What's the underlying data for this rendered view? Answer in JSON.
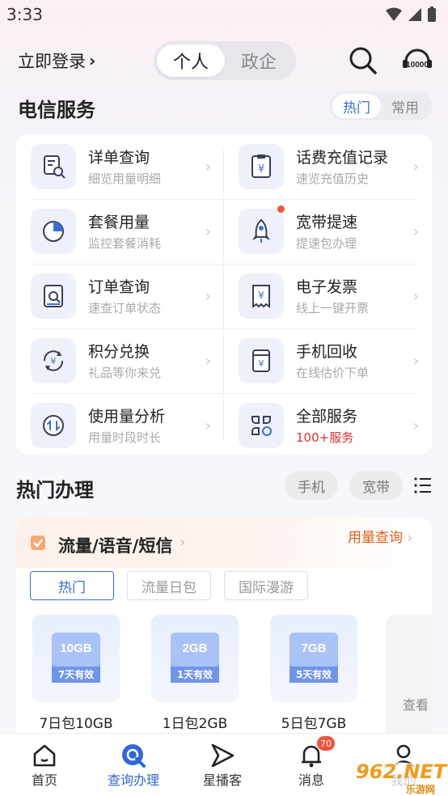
{
  "status": {
    "time": "3:33"
  },
  "header": {
    "login_label": "立即登录",
    "segments": [
      "个人",
      "政企"
    ],
    "cs_badge": "10000"
  },
  "telecom": {
    "title": "电信服务",
    "toggle": [
      "热门",
      "常用"
    ],
    "services": [
      {
        "title": "详单查询",
        "sub": "细览用量明细",
        "icon": "detail-search-icon"
      },
      {
        "title": "话费充值记录",
        "sub": "速览充值历史",
        "icon": "recharge-record-icon"
      },
      {
        "title": "套餐用量",
        "sub": "监控套餐消耗",
        "icon": "pie-chart-icon"
      },
      {
        "title": "宽带提速",
        "sub": "提速包办理",
        "icon": "rocket-icon"
      },
      {
        "title": "订单查询",
        "sub": "速查订单状态",
        "icon": "order-search-icon"
      },
      {
        "title": "电子发票",
        "sub": "线上一键开票",
        "icon": "invoice-icon"
      },
      {
        "title": "积分兑换",
        "sub": "礼品等你来兑",
        "icon": "points-exchange-icon"
      },
      {
        "title": "手机回收",
        "sub": "在线估价下单",
        "icon": "phone-recycle-icon"
      },
      {
        "title": "使用量分析",
        "sub": "用量时段时长",
        "icon": "usage-analysis-icon"
      },
      {
        "title": "全部服务",
        "sub": "100+服务",
        "icon": "all-services-icon"
      }
    ]
  },
  "hot": {
    "title": "热门办理",
    "pills": [
      "手机",
      "宽带"
    ],
    "card_title": "流量/语音/短信",
    "card_link": "用量查询",
    "tabs": [
      "热门",
      "流量日包",
      "国际漫游"
    ],
    "packages": [
      {
        "size": "10GB",
        "valid": "7天有效",
        "name": "7日包10GB"
      },
      {
        "size": "2GB",
        "valid": "1天有效",
        "name": "1日包2GB"
      },
      {
        "size": "7GB",
        "valid": "5天有效",
        "name": "5日包7GB"
      }
    ],
    "more_label": "查看"
  },
  "nav": {
    "items": [
      "首页",
      "查询办理",
      "星播客",
      "消息",
      "我的"
    ],
    "message_badge": "70"
  },
  "watermark": "962.NET",
  "watermark_sub": "乐游网"
}
